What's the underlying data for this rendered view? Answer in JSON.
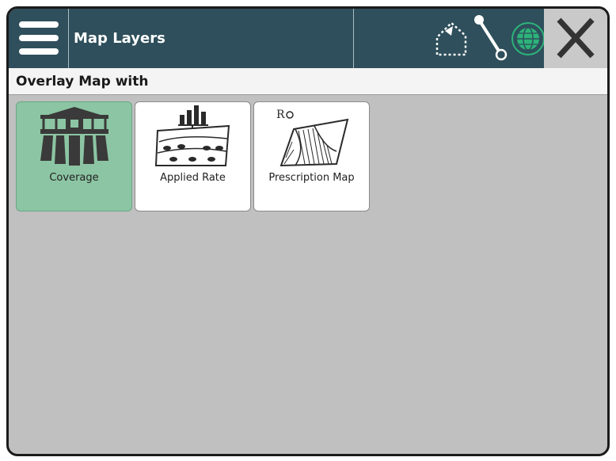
{
  "header": {
    "title": "Map Layers",
    "icons": [
      "menu-icon",
      "boundary-icon",
      "guideline-icon",
      "globe-icon",
      "close-icon"
    ]
  },
  "section": {
    "title": "Overlay Map with"
  },
  "options": [
    {
      "label": "Coverage",
      "selected": true,
      "icon": "coverage-icon"
    },
    {
      "label": "Applied Rate",
      "selected": false,
      "icon": "applied-rate-icon"
    },
    {
      "label": "Prescription Map",
      "selected": false,
      "icon": "prescription-map-icon"
    }
  ],
  "colors": {
    "header": "#2e4f5b",
    "selected": "#8cc5a3",
    "accent_green": "#2db37a",
    "panel": "#c0c0c0"
  }
}
